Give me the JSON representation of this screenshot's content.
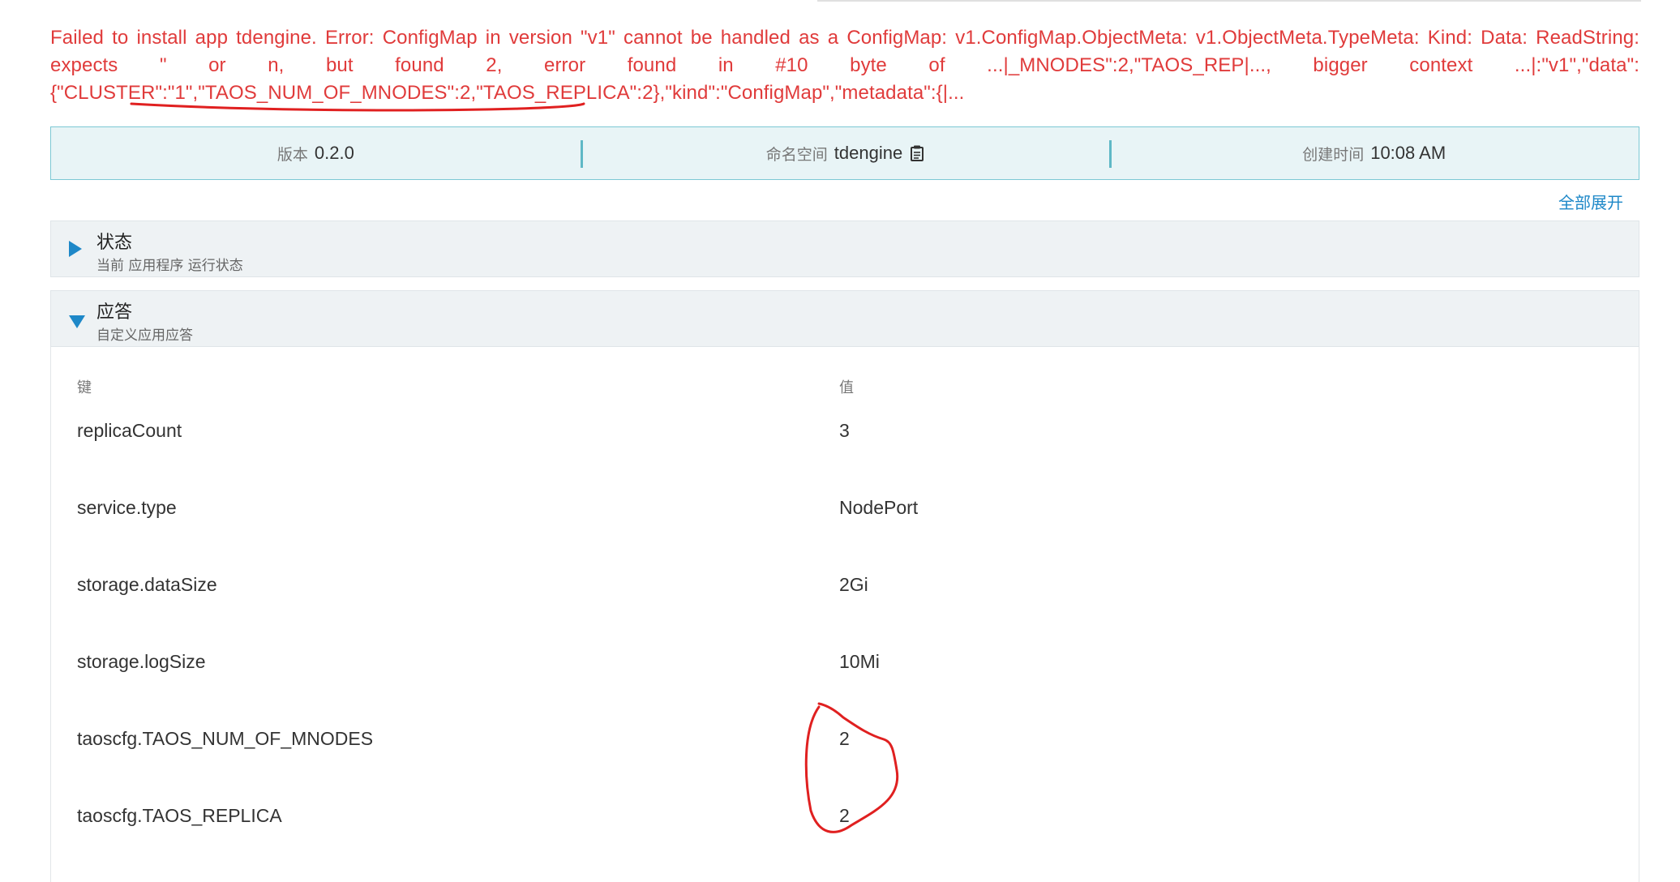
{
  "error": {
    "message": "Failed to install app tdengine. Error: ConfigMap in version \"v1\" cannot be handled as a ConfigMap: v1.ConfigMap.ObjectMeta: v1.ObjectMeta.TypeMeta: Kind: Data: ReadString: expects \" or n, but found 2, error found in #10 byte of ...|_MNODES\":2,\"TAOS_REP|..., bigger context ...|:\"v1\",\"data\": {\"CLUSTER\":\"1\",\"TAOS_NUM_OF_MNODES\":2,\"TAOS_REPLICA\":2},\"kind\":\"ConfigMap\",\"metadata\":{|..."
  },
  "meta": {
    "version_label": "版本",
    "version_value": "0.2.0",
    "namespace_label": "命名空间",
    "namespace_value": "tdengine",
    "created_label": "创建时间",
    "created_value": "10:08 AM"
  },
  "expand_all_label": "全部展开",
  "sections": {
    "status": {
      "title": "状态",
      "subtitle": "当前 应用程序 运行状态"
    },
    "answers": {
      "title": "应答",
      "subtitle": "自定义应用应答"
    }
  },
  "answers_table": {
    "key_header": "键",
    "value_header": "值",
    "rows": [
      {
        "key": "replicaCount",
        "value": "3"
      },
      {
        "key": "service.type",
        "value": "NodePort"
      },
      {
        "key": "storage.dataSize",
        "value": "2Gi"
      },
      {
        "key": "storage.logSize",
        "value": "10Mi"
      },
      {
        "key": "taoscfg.TAOS_NUM_OF_MNODES",
        "value": "2"
      },
      {
        "key": "taoscfg.TAOS_REPLICA",
        "value": "2"
      }
    ]
  },
  "colors": {
    "error": "#e03b3b",
    "accent": "#1e88c8",
    "annotation": "#e02020",
    "meta_bg": "#e8f4f6"
  }
}
